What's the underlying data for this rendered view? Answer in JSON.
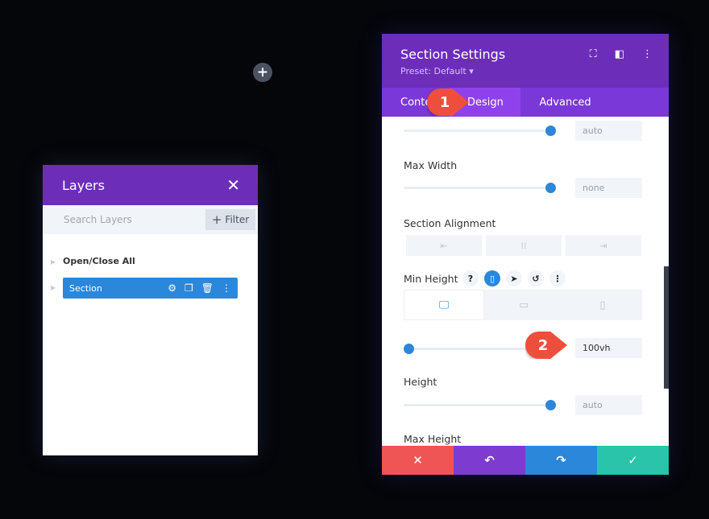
{
  "canvas": {
    "add_icon": "plus-icon"
  },
  "layers": {
    "title": "Layers",
    "close_icon": "close-icon",
    "search_placeholder": "Search Layers",
    "filter_label": "Filter",
    "open_close_all": "Open/Close All",
    "items": [
      {
        "label": "Section",
        "actions": [
          "gear-icon",
          "duplicate-icon",
          "trash-icon",
          "more-icon"
        ]
      }
    ]
  },
  "settings": {
    "title": "Section Settings",
    "preset": "Preset: Default",
    "tabs": [
      {
        "label": "Conte"
      },
      {
        "label": "Design",
        "active": true
      },
      {
        "label": "Advanced"
      }
    ],
    "fields": [
      {
        "label": "",
        "value": "auto",
        "slider": 1.0
      },
      {
        "label": "Max Width",
        "value": "none",
        "slider": 1.0
      },
      {
        "label": "Section Alignment"
      },
      {
        "label": "Min Height",
        "value": "100vh",
        "slider": 0.0,
        "help": "?"
      },
      {
        "label": "Height",
        "value": "auto",
        "slider": 1.0
      },
      {
        "label": "Max Height"
      }
    ],
    "footer": [
      "close-icon",
      "undo-icon",
      "redo-icon",
      "check-icon"
    ]
  },
  "callouts": [
    "1",
    "2"
  ],
  "colors": {
    "purple": "#6c2eb9",
    "tab_active": "#8f42ec",
    "blue": "#2b87da",
    "red": "#ee4f3c",
    "green": "#29c4a9",
    "footer_purple": "#7e3bd0"
  }
}
